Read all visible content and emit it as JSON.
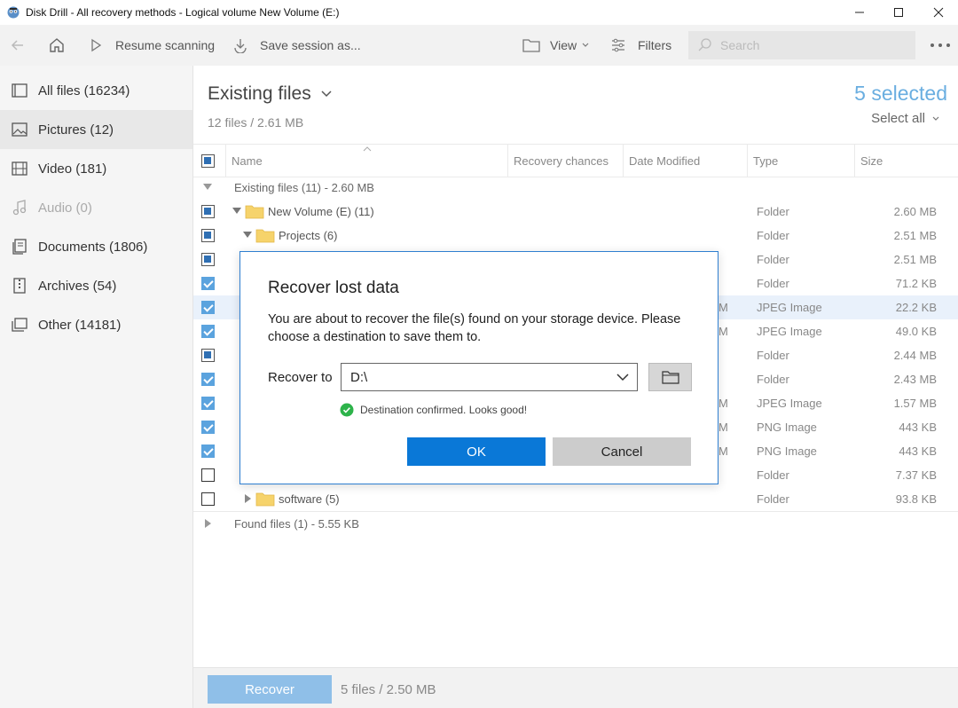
{
  "window": {
    "title": "Disk Drill - All recovery methods - Logical volume New Volume (E:)"
  },
  "toolbar": {
    "resume_label": "Resume scanning",
    "save_label": "Save session as...",
    "view_label": "View",
    "filters_label": "Filters",
    "search_placeholder": "Search"
  },
  "sidebar": {
    "items": [
      {
        "label": "All files (16234)",
        "icon": "all-files-icon"
      },
      {
        "label": "Pictures (12)",
        "icon": "pictures-icon"
      },
      {
        "label": "Video (181)",
        "icon": "video-icon"
      },
      {
        "label": "Audio (0)",
        "icon": "audio-icon"
      },
      {
        "label": "Documents (1806)",
        "icon": "documents-icon"
      },
      {
        "label": "Archives (54)",
        "icon": "archives-icon"
      },
      {
        "label": "Other (14181)",
        "icon": "other-icon"
      }
    ]
  },
  "main": {
    "title": "Existing files",
    "subtitle": "12 files / 2.61 MB",
    "selected": "5 selected",
    "select_all": "Select all",
    "columns": [
      "Name",
      "Recovery chances",
      "Date Modified",
      "Type",
      "Size"
    ],
    "group_existing": "Existing files (11) - 2.60 MB",
    "group_found": "Found files (1) - 5.55 KB",
    "rows": [
      {
        "name": "New Volume (E) (11)",
        "frag": "",
        "type": "Folder",
        "size": "2.60 MB"
      },
      {
        "name": "Projects (6)",
        "frag": "",
        "type": "Folder",
        "size": "2.51 MB"
      },
      {
        "name": "",
        "frag": "",
        "type": "Folder",
        "size": "2.51 MB"
      },
      {
        "name": "",
        "frag": "",
        "type": "Folder",
        "size": "71.2 KB"
      },
      {
        "name": "",
        "frag": "M",
        "type": "JPEG Image",
        "size": "22.2 KB"
      },
      {
        "name": "",
        "frag": "M",
        "type": "JPEG Image",
        "size": "49.0 KB"
      },
      {
        "name": "",
        "frag": "",
        "type": "Folder",
        "size": "2.44 MB"
      },
      {
        "name": "",
        "frag": "",
        "type": "Folder",
        "size": "2.43 MB"
      },
      {
        "name": "",
        "frag": "M",
        "type": "JPEG Image",
        "size": "1.57 MB"
      },
      {
        "name": "",
        "frag": "M",
        "type": "PNG Image",
        "size": "443 KB"
      },
      {
        "name": "",
        "frag": "M",
        "type": "PNG Image",
        "size": "443 KB"
      },
      {
        "name": "",
        "frag": "",
        "type": "Folder",
        "size": "7.37 KB"
      },
      {
        "name": "software (5)",
        "frag": "",
        "type": "Folder",
        "size": "93.8 KB"
      }
    ]
  },
  "bottom": {
    "recover_label": "Recover",
    "info": "5 files / 2.50 MB"
  },
  "dialog": {
    "title": "Recover lost data",
    "message": "You are about to recover the file(s) found on your storage device. Please choose a destination to save them to.",
    "recover_to_label": "Recover to",
    "destination": "D:\\",
    "confirm_text": "Destination confirmed. Looks good!",
    "ok_label": "OK",
    "cancel_label": "Cancel"
  },
  "colors": {
    "accent": "#0a78d7",
    "selected_text": "#6aaee0",
    "checkbox_checked": "#5ba3de",
    "confirm_green": "#2db34a",
    "folder_yellow": "#f6d36b"
  }
}
